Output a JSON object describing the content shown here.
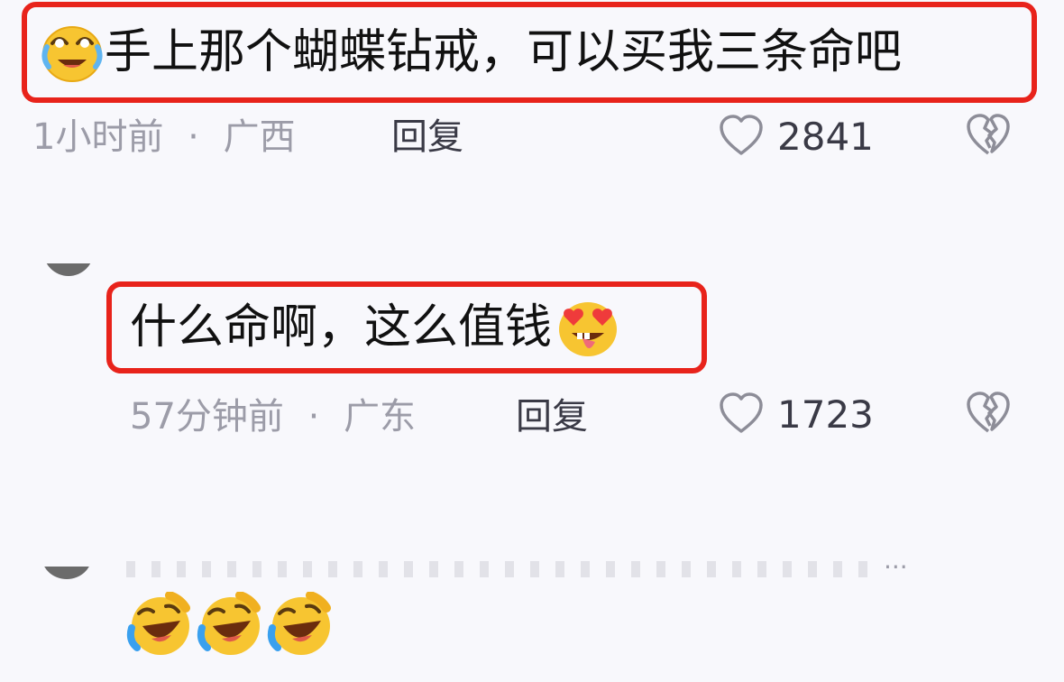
{
  "comments": [
    {
      "text": "手上那个蝴蝶钻戒，可以买我三条命吧",
      "leading_emoji": "tears-of-joy-emoji",
      "time": "1小时前",
      "separator": "·",
      "location": "广西",
      "reply_label": "回复",
      "likes": "2841"
    },
    {
      "text": "什么命啊，这么值钱",
      "trailing_emoji": "heart-eyes-tongue-emoji",
      "time": "57分钟前",
      "separator": "·",
      "location": "广东",
      "reply_label": "回复",
      "likes": "1723"
    },
    {
      "text": "",
      "ellipsis": "...",
      "emojis": [
        "laughing-crying-emoji",
        "laughing-crying-emoji",
        "laughing-crying-emoji"
      ]
    }
  ],
  "colors": {
    "highlight_border": "#e8231b",
    "background": "#f8f8fc",
    "meta_text": "#9c9ca8",
    "icon_gray": "#8d8d98"
  }
}
